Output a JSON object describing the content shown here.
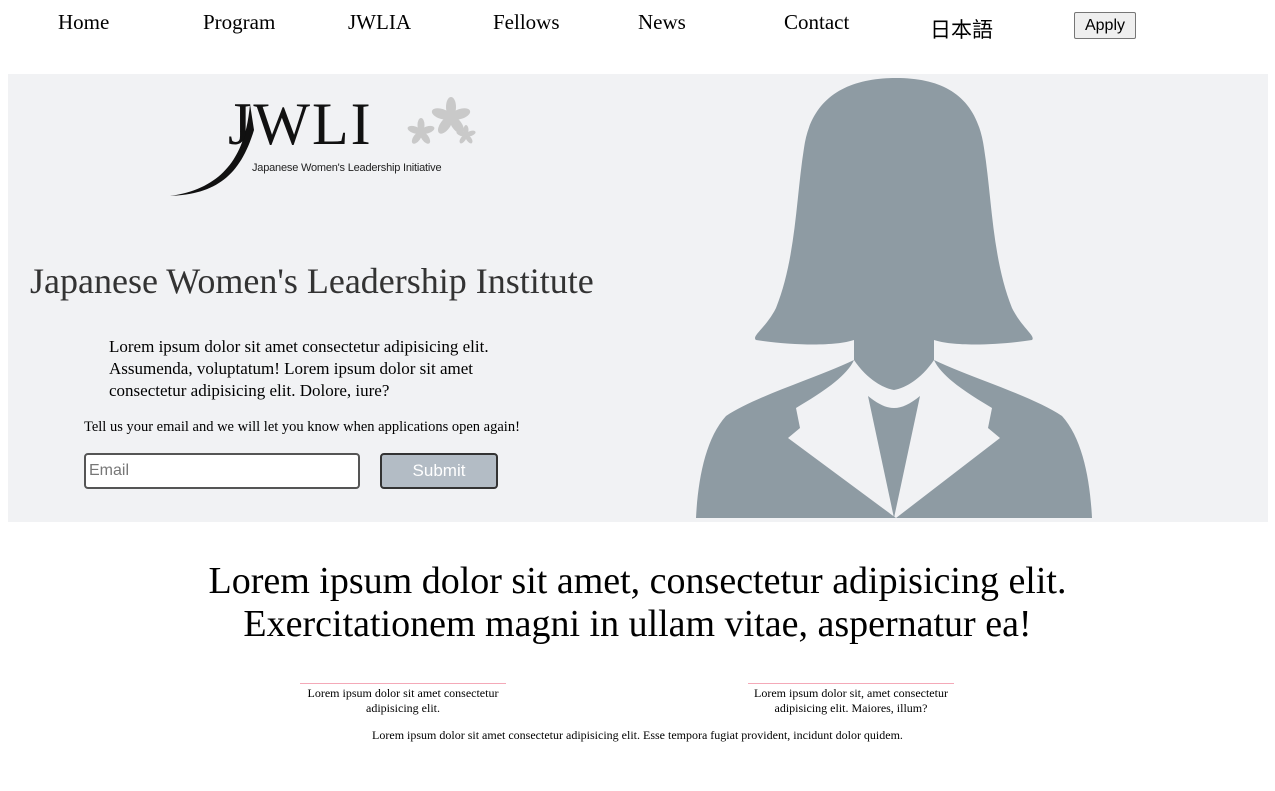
{
  "nav": {
    "items": [
      {
        "label": "Home"
      },
      {
        "label": "Program"
      },
      {
        "label": "JWLIA"
      },
      {
        "label": "Fellows"
      },
      {
        "label": "News"
      },
      {
        "label": "Contact"
      },
      {
        "label": "日本語"
      }
    ],
    "apply_label": "Apply"
  },
  "hero": {
    "logo_text": "JWLI",
    "logo_subtitle": "Japanese Women's Leadership Initiative",
    "title": "Japanese Women's Leadership Institute",
    "description": "Lorem ipsum dolor sit amet consectetur adipisicing elit. Assumenda, voluptatum! Lorem ipsum dolor sit amet consectetur adipisicing elit. Dolore, iure?",
    "prompt": "Tell us your email and we will let you know when applications open again!",
    "email_placeholder": "Email",
    "email_value": "",
    "submit_label": "Submit",
    "background_color": "#f1f2f4",
    "silhouette_color": "#8e9ba3"
  },
  "tagline": {
    "line1": "Lorem ipsum dolor sit amet, consectetur adipisicing elit.",
    "line2": "Exercitationem magni in ullam vitae, aspernatur ea!"
  },
  "features": [
    {
      "text": "Lorem ipsum dolor sit amet consectetur adipisicing elit."
    },
    {
      "text": "Lorem ipsum dolor sit, amet consectetur adipisicing elit. Maiores, illum?"
    }
  ],
  "footer": {
    "text": "Lorem ipsum dolor sit amet consectetur adipisicing elit. Esse tempora fugiat provident, incidunt dolor quidem."
  },
  "colors": {
    "feature_rule": "#f4a9b8",
    "submit_bg": "#b3bcc5"
  }
}
